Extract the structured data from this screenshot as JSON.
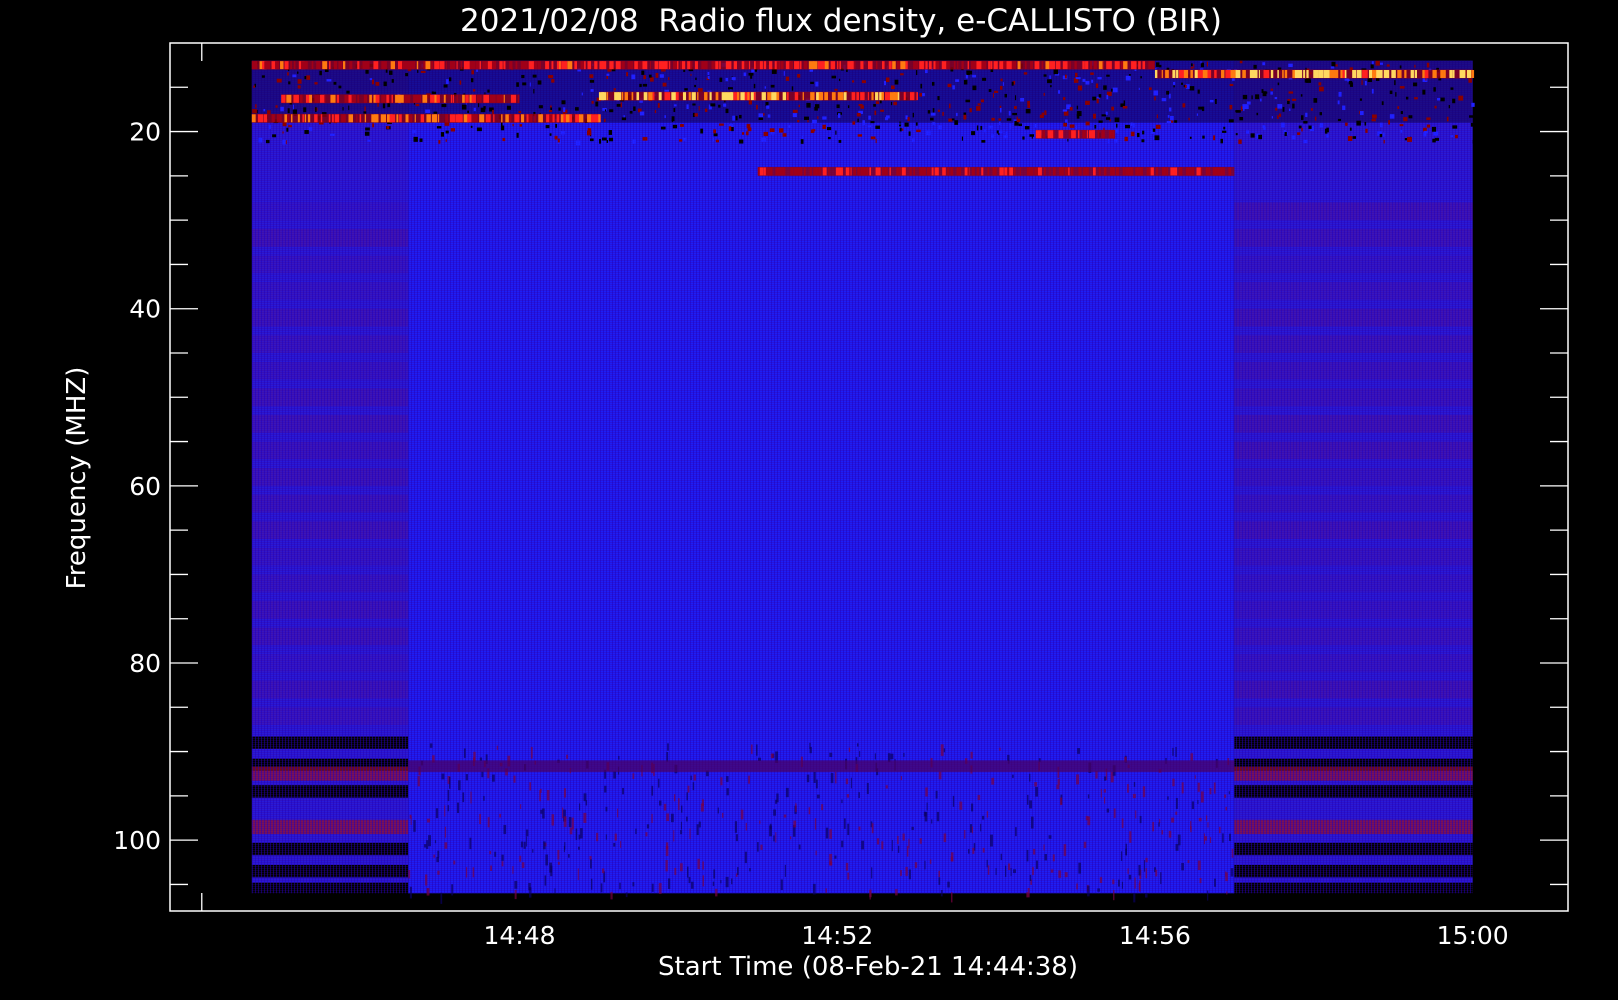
{
  "chart_data": {
    "type": "heatmap",
    "title": "2021/02/08  Radio flux density, e-CALLISTO (BIR)",
    "xlabel": "Start Time (08-Feb-21 14:44:38)",
    "ylabel": "Frequency (MHZ)",
    "x_axis": {
      "ticks": [
        {
          "label": "14:48",
          "minutes": 288
        },
        {
          "label": "14:52",
          "minutes": 292
        },
        {
          "label": "14:56",
          "minutes": 296
        },
        {
          "label": "15:00",
          "minutes": 300
        }
      ],
      "range_minutes": [
        283.6,
        301.2
      ],
      "minor_step_minutes": 1
    },
    "y_axis": {
      "ticks": [
        20,
        40,
        60,
        80,
        100
      ],
      "minor_step": 5,
      "range": [
        10,
        108
      ],
      "reversed": true
    },
    "data_extent": {
      "time_start_minutes": 284.63,
      "time_end_minutes": 300,
      "freq_min_mhz": 12,
      "freq_max_mhz": 106
    },
    "segments": [
      {
        "t0": 284.63,
        "t1": 286.6,
        "kind": "quiet"
      },
      {
        "t0": 286.6,
        "t1": 297.0,
        "kind": "active"
      },
      {
        "t0": 297.0,
        "t1": 300.0,
        "kind": "quiet"
      }
    ],
    "emission_bands": [
      {
        "t0": 284.63,
        "t1": 296.0,
        "freq": 12.5,
        "intensity": 0.55
      },
      {
        "t0": 296.0,
        "t1": 300.0,
        "freq": 13.5,
        "intensity": 0.9
      },
      {
        "t0": 289.0,
        "t1": 293.0,
        "freq": 16.0,
        "intensity": 0.85
      },
      {
        "t0": 285.0,
        "t1": 288.0,
        "freq": 16.3,
        "intensity": 0.6
      },
      {
        "t0": 284.63,
        "t1": 289.0,
        "freq": 18.5,
        "intensity": 0.65
      },
      {
        "t0": 291.0,
        "t1": 297.0,
        "freq": 24.5,
        "intensity": 0.45
      },
      {
        "t0": 294.5,
        "t1": 295.5,
        "freq": 20.3,
        "intensity": 0.5
      }
    ],
    "gap_bands_quiet": [
      89,
      91.5,
      94.5,
      101,
      103.5,
      105.5
    ],
    "colormap": [
      "#000000",
      "#0000ff",
      "#8b0000",
      "#ff0000",
      "#ffa500",
      "#ffff80"
    ]
  }
}
